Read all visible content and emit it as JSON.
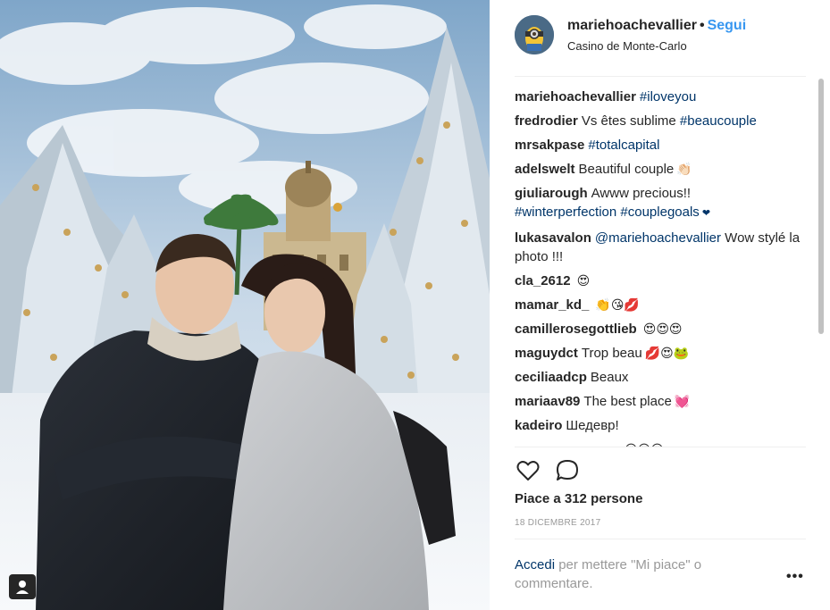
{
  "header": {
    "username": "mariehoachevallier",
    "separator": "•",
    "follow_label": "Segui",
    "location": "Casino de Monte-Carlo"
  },
  "comments": [
    {
      "user": "mariehoachevallier",
      "text": "",
      "tags": "#iloveyou",
      "emoji": ""
    },
    {
      "user": "fredrodier",
      "text": "Vs êtes sublime ",
      "tags": "#beaucouple",
      "emoji": ""
    },
    {
      "user": "mrsakpase",
      "text": "",
      "tags": "#totalcapital",
      "emoji": ""
    },
    {
      "user": "adelswelt",
      "text": "Beautiful couple",
      "tags": "",
      "emoji": "👏🏻"
    },
    {
      "user": "giuliarough",
      "text": "Awww precious!!",
      "tags": "#winterperfection #couplegoals",
      "emoji": "❤"
    },
    {
      "user": "lukasavalon",
      "text": "",
      "tags": "@mariehoachevallier",
      "text2": " Wow stylé la photo !!!",
      "emoji": ""
    },
    {
      "user": "cla_2612",
      "text": "",
      "tags": "",
      "emoji": "😍"
    },
    {
      "user": "mamar_kd_",
      "text": "",
      "tags": "",
      "emoji": "👏😘💋"
    },
    {
      "user": "camillerosegottlieb",
      "text": "",
      "tags": "",
      "emoji": "😍😍😍"
    },
    {
      "user": "maguydct",
      "text": "Trop beau",
      "tags": "",
      "emoji": "💋😍🐸"
    },
    {
      "user": "ceciliaadcp",
      "text": "Beaux",
      "tags": "",
      "emoji": ""
    },
    {
      "user": "mariaav89",
      "text": "The best place",
      "tags": "",
      "emoji": "💓"
    },
    {
      "user": "kadeiro",
      "text": "Шедевр!",
      "tags": "",
      "emoji": ""
    },
    {
      "user": "",
      "text": "",
      "tags": "",
      "emoji": "😍😍😍"
    }
  ],
  "actions": {
    "like_icon": "heart-outline-icon",
    "comment_icon": "speech-bubble-icon"
  },
  "likes": "Piace a 312 persone",
  "date": "18 DICEMBRE 2017",
  "login": {
    "link": "Accedi",
    "text": " per mettere \"Mi piace\" o commentare."
  },
  "more_label": "•••",
  "colors": {
    "link_blue": "#3897f0",
    "hashtag": "#003569",
    "muted": "#999999"
  }
}
